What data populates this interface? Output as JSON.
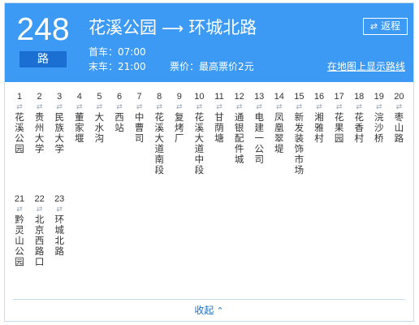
{
  "route": {
    "number": "248",
    "unit": "路",
    "from": "花溪公园",
    "arrow": "⟶",
    "to": "环城北路",
    "first_bus": "首车：07:00",
    "last_bus": "末车：21:00",
    "fare": "票价：最高票价2元",
    "map_link": "在地图上显示路线",
    "reverse_label": "返程",
    "reverse_icon": "⇄"
  },
  "stops": [
    {
      "num": "1",
      "name": "花溪公园"
    },
    {
      "num": "2",
      "name": "贵州大学"
    },
    {
      "num": "3",
      "name": "民族大学"
    },
    {
      "num": "4",
      "name": "董家堰"
    },
    {
      "num": "5",
      "name": "大水沟"
    },
    {
      "num": "6",
      "name": "西站"
    },
    {
      "num": "7",
      "name": "中曹司"
    },
    {
      "num": "8",
      "name": "花溪大道南段"
    },
    {
      "num": "9",
      "name": "复烤厂"
    },
    {
      "num": "10",
      "name": "花溪大道中段"
    },
    {
      "num": "11",
      "name": "甘荫塘"
    },
    {
      "num": "12",
      "name": "通银配件城"
    },
    {
      "num": "13",
      "name": "电建一公司"
    },
    {
      "num": "14",
      "name": "凤凰翠堤"
    },
    {
      "num": "15",
      "name": "新发装饰市场"
    },
    {
      "num": "16",
      "name": "湘雅村"
    },
    {
      "num": "17",
      "name": "花果园"
    },
    {
      "num": "18",
      "name": "花香村"
    },
    {
      "num": "19",
      "name": "浣沙桥"
    },
    {
      "num": "20",
      "name": "枣山路"
    },
    {
      "num": "21",
      "name": "黔灵山公园"
    },
    {
      "num": "22",
      "name": "北京西路口"
    },
    {
      "num": "23",
      "name": "环城北路"
    }
  ],
  "stop_direction_icon": "⇄",
  "collapse": {
    "label": "收起",
    "icon": "⌃"
  }
}
